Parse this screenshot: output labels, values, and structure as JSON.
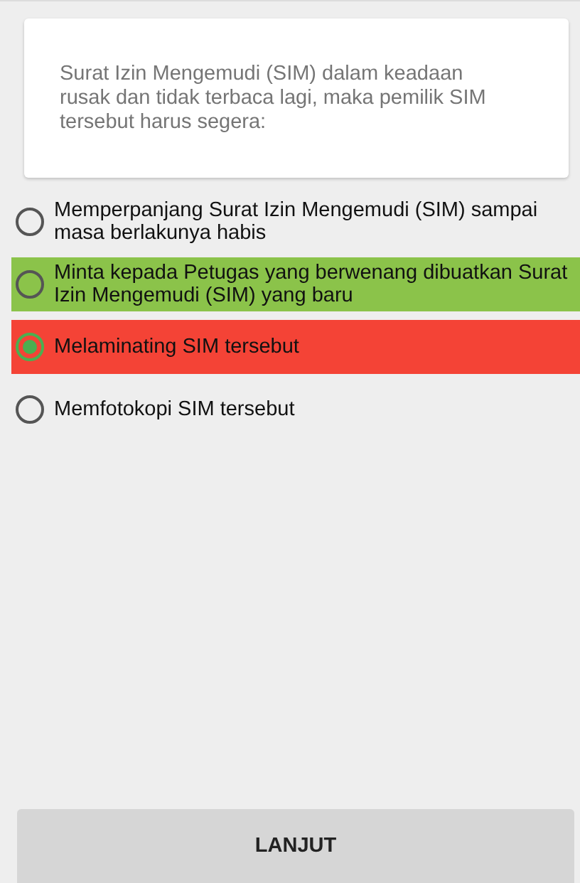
{
  "question": "Surat Izin Mengemudi (SIM) dalam keadaan rusak dan tidak terbaca lagi, maka pemilik SIM tersebut harus segera:",
  "options": [
    {
      "label": "Memperpanjang Surat Izin Mengemudi (SIM) sampai masa berlakunya habis",
      "selected": false
    },
    {
      "label": "Minta kepada Petugas yang berwenang dibuatkan Surat Izin Mengemudi (SIM) yang baru",
      "selected": false,
      "color": "#8bc34a"
    },
    {
      "label": "Melaminating SIM tersebut",
      "selected": true,
      "color": "#f44336"
    },
    {
      "label": "Memfotokopi SIM tersebut",
      "selected": false
    }
  ],
  "next_button": "LANJUT"
}
